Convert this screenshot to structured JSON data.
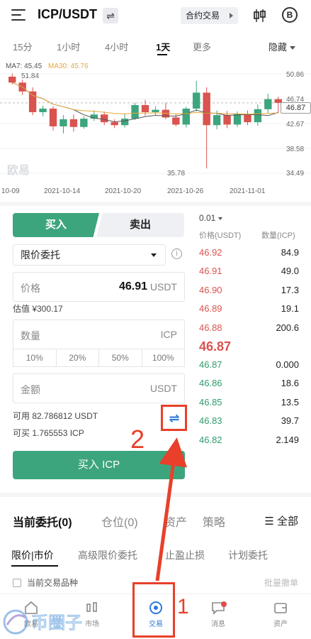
{
  "header": {
    "pair": "ICP/USDT",
    "contract_label": "合约交易",
    "b_label": "B"
  },
  "tabs": [
    {
      "label": "15分"
    },
    {
      "label": "1小时"
    },
    {
      "label": "4小时"
    },
    {
      "label": "1天"
    },
    {
      "label": "更多"
    }
  ],
  "hide_label": "隐藏",
  "chart": {
    "ma7": "MA7: 45.45",
    "ma30": "MA30: 45.76",
    "high_label": "51.84",
    "low_label": "35.78",
    "y_ticks": [
      "50.86",
      "46.74",
      "42.67",
      "38.58",
      "34.49"
    ],
    "x_ticks": [
      "10-09",
      "2021-10-14",
      "2021-10-20",
      "2021-10-26",
      "2021-11-01"
    ],
    "current_price": "46.87",
    "watermark": "欧易",
    "colors": {
      "up": "#3da57d",
      "down": "#d9534f",
      "ma7": "#555555",
      "ma30": "#e7a83a"
    }
  },
  "chart_data": {
    "type": "candlestick",
    "x": [
      "2021-10-09",
      "2021-10-10",
      "2021-10-11",
      "2021-10-12",
      "2021-10-13",
      "2021-10-14",
      "2021-10-15",
      "2021-10-16",
      "2021-10-17",
      "2021-10-18",
      "2021-10-19",
      "2021-10-20",
      "2021-10-21",
      "2021-10-22",
      "2021-10-23",
      "2021-10-24",
      "2021-10-25",
      "2021-10-26",
      "2021-10-27",
      "2021-10-28",
      "2021-10-29",
      "2021-10-30",
      "2021-10-31",
      "2021-11-01",
      "2021-11-02",
      "2021-11-03",
      "2021-11-04"
    ],
    "ohlc": [
      [
        51.3,
        51.84,
        50.0,
        50.3
      ],
      [
        50.3,
        50.8,
        48.2,
        48.8
      ],
      [
        48.8,
        49.5,
        44.8,
        45.3
      ],
      [
        45.3,
        46.4,
        44.6,
        45.9
      ],
      [
        45.9,
        46.3,
        42.2,
        42.9
      ],
      [
        42.9,
        44.8,
        41.7,
        44.1
      ],
      [
        44.1,
        44.9,
        42.0,
        42.8
      ],
      [
        42.8,
        44.6,
        42.5,
        44.2
      ],
      [
        44.2,
        45.6,
        43.8,
        44.9
      ],
      [
        44.9,
        45.4,
        43.1,
        43.6
      ],
      [
        43.6,
        44.1,
        42.6,
        43.1
      ],
      [
        43.1,
        45.0,
        42.7,
        44.2
      ],
      [
        44.2,
        46.9,
        44.0,
        46.5
      ],
      [
        46.5,
        47.4,
        44.7,
        45.3
      ],
      [
        45.3,
        46.3,
        44.8,
        45.7
      ],
      [
        45.7,
        46.9,
        44.1,
        44.4
      ],
      [
        44.4,
        45.0,
        42.9,
        43.2
      ],
      [
        43.2,
        46.2,
        42.7,
        45.9
      ],
      [
        45.9,
        50.6,
        45.4,
        48.6
      ],
      [
        48.6,
        49.5,
        35.78,
        43.1
      ],
      [
        43.1,
        45.6,
        42.4,
        44.8
      ],
      [
        44.8,
        45.5,
        42.6,
        43.2
      ],
      [
        43.2,
        45.4,
        42.8,
        45.0
      ],
      [
        45.0,
        45.6,
        43.1,
        43.6
      ],
      [
        43.6,
        46.6,
        43.0,
        45.8
      ],
      [
        45.8,
        48.4,
        45.1,
        47.5
      ],
      [
        47.5,
        47.9,
        45.2,
        46.87
      ]
    ],
    "ylim": [
      34.49,
      52.5
    ]
  },
  "trade": {
    "buy_tab": "买入",
    "sell_tab": "卖出",
    "order_type": "限价委托",
    "info_icon": "i",
    "price_label": "价格",
    "price_value": "46.91",
    "unit_usdt": "USDT",
    "estimate": "估值 ¥300.17",
    "qty_label": "数量",
    "unit_icp": "ICP",
    "percents": [
      "10%",
      "20%",
      "50%",
      "100%"
    ],
    "amount_label": "金额",
    "available": "可用 82.786812 USDT",
    "can_buy": "可买 1.765553 ICP",
    "buy_button": "买入 ICP",
    "swap_icon": "⇌"
  },
  "orderbook": {
    "precision": "0.01",
    "price_head": "价格(USDT)",
    "qty_head": "数量(ICP)",
    "asks": [
      {
        "p": "46.92",
        "q": "84.9"
      },
      {
        "p": "46.91",
        "q": "49.0"
      },
      {
        "p": "46.90",
        "q": "17.3"
      },
      {
        "p": "46.89",
        "q": "19.1"
      },
      {
        "p": "46.88",
        "q": "200.6"
      }
    ],
    "last": "46.87",
    "bids": [
      {
        "p": "46.87",
        "q": "0.000"
      },
      {
        "p": "46.86",
        "q": "18.6"
      },
      {
        "p": "46.85",
        "q": "13.5"
      },
      {
        "p": "46.83",
        "q": "39.7"
      },
      {
        "p": "46.82",
        "q": "2.149"
      }
    ]
  },
  "orders": {
    "tabs": [
      "当前委托(0)",
      "仓位(0)",
      "资产",
      "策略"
    ],
    "all": "全部",
    "sub_tabs": [
      "限价|市价",
      "高级限价委托",
      "止盈止损",
      "计划委托"
    ],
    "current_pair": "当前交易品种",
    "batch_cancel": "批量撤单"
  },
  "nav": [
    {
      "label": "欧易",
      "icon": "home-icon"
    },
    {
      "label": "市场",
      "icon": "market-icon"
    },
    {
      "label": "交易",
      "icon": "trade-icon"
    },
    {
      "label": "消息",
      "icon": "message-icon"
    },
    {
      "label": "资产",
      "icon": "wallet-icon"
    }
  ],
  "annotations": {
    "step1": "1",
    "step2": "2",
    "color": "#e8402a",
    "logo_text": "币圈子"
  }
}
